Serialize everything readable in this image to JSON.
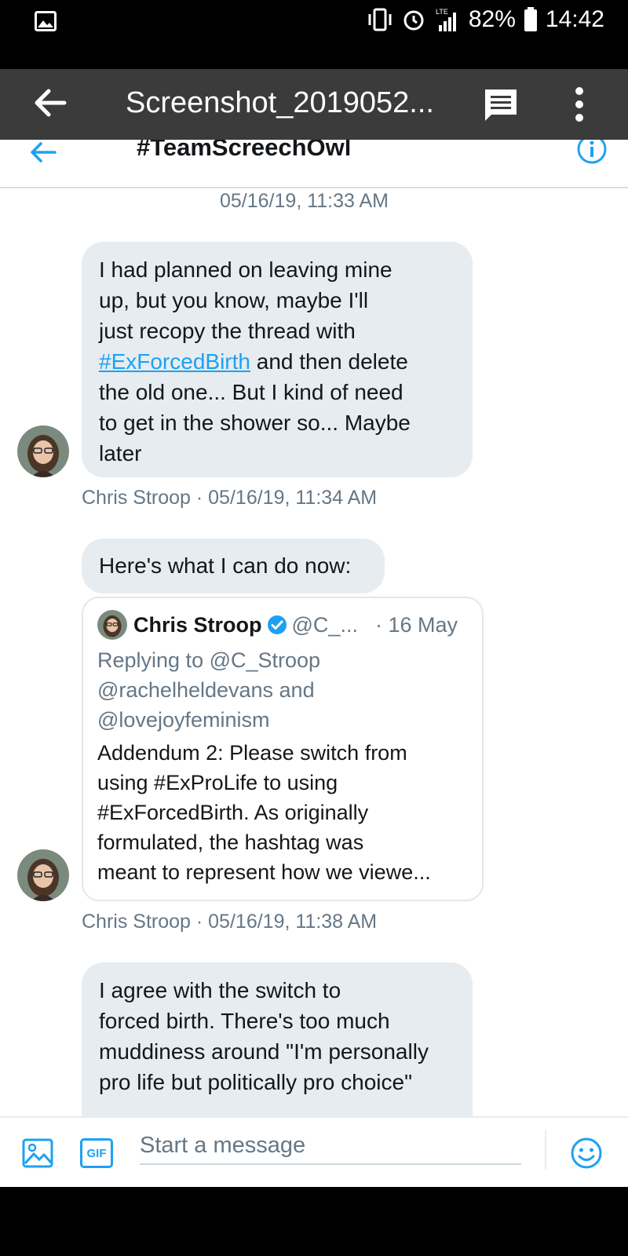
{
  "status_bar": {
    "battery": "82%",
    "time": "14:42",
    "network": "LTE"
  },
  "viewer": {
    "title": "Screenshot_2019052..."
  },
  "conversation": {
    "title": "#TeamScreechOwl",
    "top_timestamp": "05/16/19, 11:33 AM",
    "messages": [
      {
        "lines": [
          "I had planned on leaving mine",
          "up, but you know, maybe I'll",
          "just recopy the thread with"
        ],
        "hashtag": "#ExForcedBirth",
        "hashtag_tail": " and then delete",
        "lines_after": [
          "the old one... But I kind of need",
          "to get in the shower so... Maybe",
          "later"
        ],
        "meta": "Chris Stroop · 05/16/19, 11:34 AM"
      },
      {
        "text": "Here's what I can do now:",
        "quote": {
          "name": "Chris Stroop",
          "handle": "@C_...",
          "date": "· 16 May",
          "reply_lines": [
            "Replying to @C_Stroop",
            "@rachelheldevans and",
            "@lovejoyfeminism"
          ],
          "text_lines": [
            "Addendum 2: Please switch from",
            "using #ExProLife to using",
            "#ExForcedBirth. As originally",
            "formulated, the hashtag was",
            "meant to represent how we viewe..."
          ]
        },
        "meta": "Chris Stroop · 05/16/19, 11:38 AM"
      },
      {
        "lines": [
          "I agree with the switch to",
          "forced birth. There's too much",
          "muddiness around \"I'm personally",
          "pro life but politically pro choice\""
        ]
      }
    ]
  },
  "composer": {
    "gif_label": "GIF",
    "placeholder": "Start a message"
  },
  "colors": {
    "accent": "#1da1f2",
    "bubble": "#e6ecf0",
    "muted": "#657786"
  },
  "icons": [
    "gallery-icon",
    "vibrate-icon",
    "alarm-icon",
    "signal-icon",
    "battery-icon",
    "back-arrow-icon",
    "message-icon",
    "more-vert-icon",
    "info-icon",
    "image-icon",
    "emoji-icon",
    "verified-icon"
  ]
}
